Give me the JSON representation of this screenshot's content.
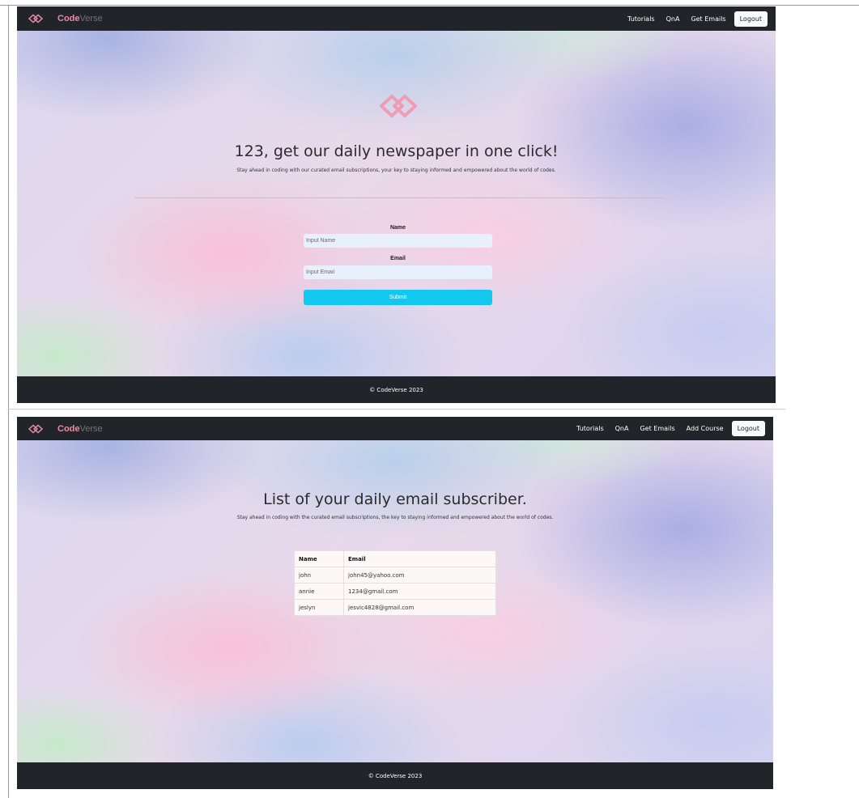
{
  "screen1": {
    "nav": {
      "brand_code": "Code",
      "brand_verse": "Verse",
      "links": [
        "Tutorials",
        "QnA",
        "Get Emails"
      ],
      "logout_label": "Logout"
    },
    "heading": "123, get our daily newspaper in one click!",
    "subheading": "Stay ahead in coding with our curated email subscriptions, your key to staying informed and empowered about the world of codes.",
    "form": {
      "name_label": "Name",
      "name_placeholder": "Input Name",
      "email_label": "Email",
      "email_placeholder": "Input Email",
      "submit_label": "Submit"
    },
    "footer": "© CodeVerse 2023"
  },
  "screen2": {
    "nav": {
      "brand_code": "Code",
      "brand_verse": "Verse",
      "links": [
        "Tutorials",
        "QnA",
        "Get Emails",
        "Add Course"
      ],
      "logout_label": "Logout"
    },
    "heading": "List of your daily email subscriber.",
    "subheading": "Stay ahead in coding with the curated email subscriptions, the key to staying informed and empowered about the world of codes.",
    "table": {
      "headers": [
        "Name",
        "Email"
      ],
      "rows": [
        [
          "john",
          "john45@yahoo.com"
        ],
        [
          "annie",
          "1234@gmail.com"
        ],
        [
          "jeslyn",
          "jesvic4828@gmail.com"
        ]
      ]
    },
    "footer": "© CodeVerse 2023"
  },
  "colors": {
    "navbar": "#212529",
    "brand_accent": "#e88ca8",
    "submit_button": "#12c8ef",
    "input_background": "#e8f0fe"
  },
  "icons": [
    "codeverse-logo-icon"
  ]
}
